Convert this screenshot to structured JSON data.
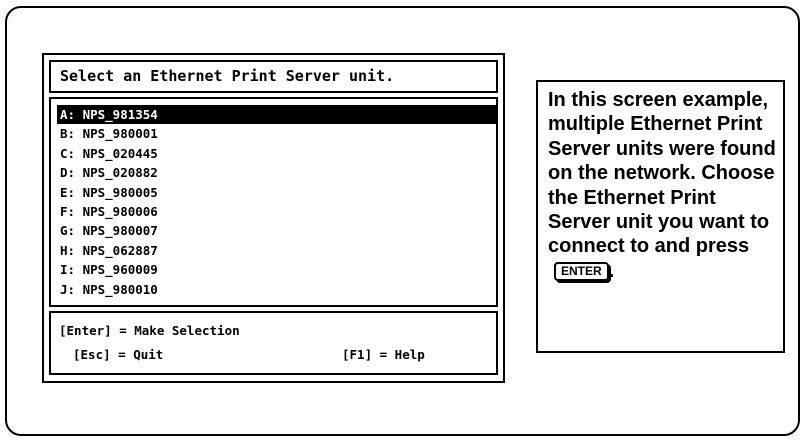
{
  "dialog": {
    "title": "Select an Ethernet Print Server unit.",
    "units": [
      "A: NPS_981354",
      "B: NPS_980001",
      "C: NPS_020445",
      "D: NPS_020882",
      "E: NPS_980005",
      "F: NPS_980006",
      "G: NPS_980007",
      "H: NPS_062887",
      "I: NPS_960009",
      "J: NPS_980010"
    ],
    "selected_index": 0,
    "keys": {
      "enter": "[Enter] = Make Selection",
      "esc": "[Esc] = Quit",
      "help": "[F1] = Help"
    }
  },
  "note": {
    "text": "In this screen example, multiple Ethernet Print Server units were found on the network.  Choose the Ethernet Print Server unit you want to connect to and press",
    "key_label": "ENTER",
    "end": "."
  }
}
